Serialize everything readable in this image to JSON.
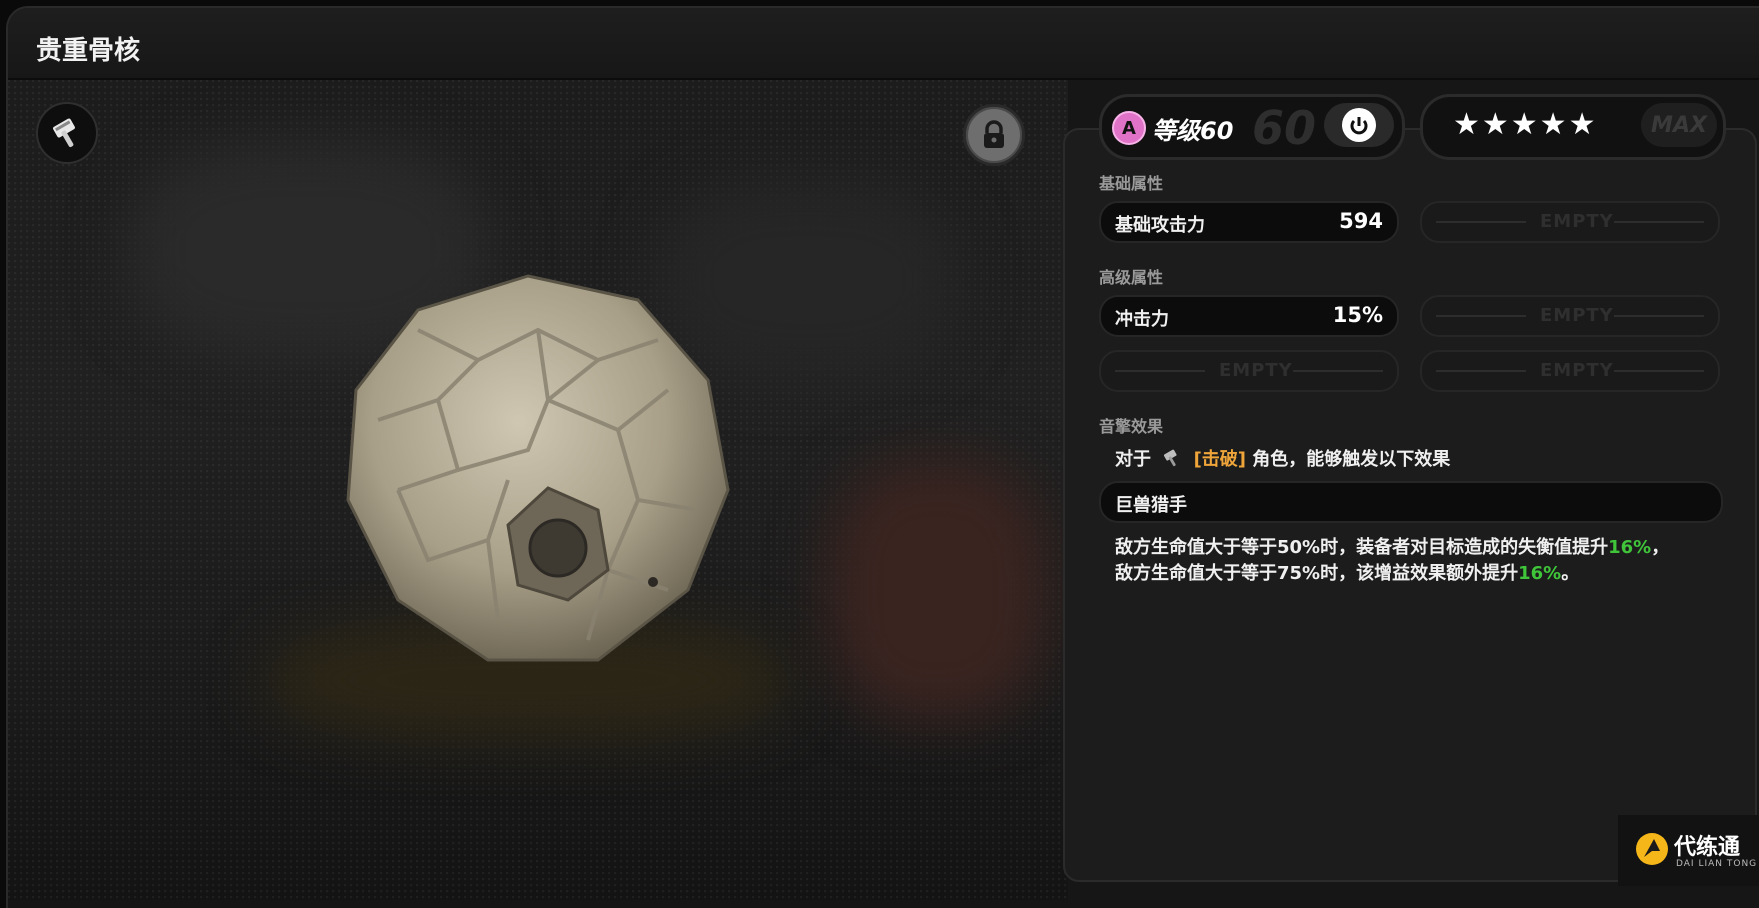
{
  "window": {
    "title": "贵重骨核"
  },
  "item": {
    "rank": "A",
    "level_label": "等级60",
    "level_max": "60",
    "stars": "★★★★★",
    "max_label": "MAX"
  },
  "base_attrs": {
    "label": "基础属性",
    "rows": [
      {
        "name": "基础攻击力",
        "value": "594"
      }
    ],
    "empty": "EMPTY"
  },
  "advanced_attrs": {
    "label": "高级属性",
    "rows": [
      {
        "name": "冲击力",
        "value": "15%"
      }
    ],
    "empty": "EMPTY"
  },
  "effect": {
    "label": "音擎效果",
    "intro_prefix": "对于",
    "intro_tag": "[击破]",
    "intro_suffix": "角色，能够触发以下效果",
    "name": "巨兽猎手",
    "line1_text": "敌方生命值大于等于50%时，装备者对目标造成的失衡值提升",
    "line1_value": "16%",
    "line1_end": "，",
    "line2_text": "敌方生命值大于等于75%时，该增益效果额外提升",
    "line2_value": "16%",
    "line2_end": "。"
  },
  "watermark": {
    "main": "代练通",
    "sub": "DAI LIAN TONG"
  },
  "icons": {
    "hammer": "hammer-icon",
    "lock": "lock-icon",
    "upgrade": "upgrade-icon",
    "bottom": "upgrade-icon"
  },
  "colors": {
    "rank": "#e072c8",
    "tag": "#f0a53a",
    "highlight": "#3fc43a"
  }
}
